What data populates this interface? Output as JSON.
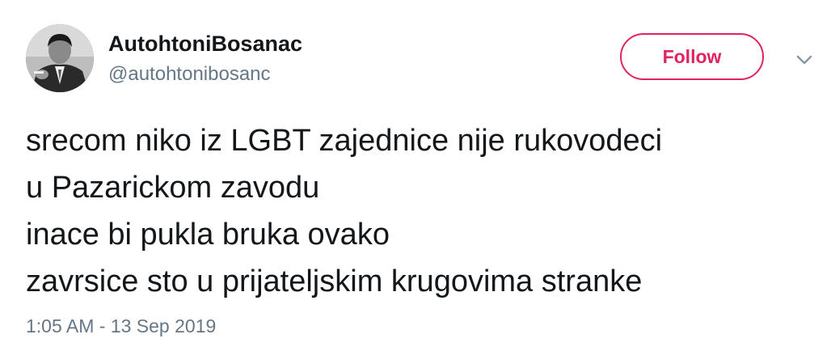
{
  "user": {
    "display_name": "AutohtoniBosanac",
    "handle": "@autohtonibosanc",
    "avatar_icon": "profile-photo"
  },
  "actions": {
    "follow_label": "Follow",
    "menu_icon": "chevron-down-icon",
    "accent_color": "#e0245e"
  },
  "tweet": {
    "lines": [
      "srecom niko iz LGBT zajednice nije rukovodeci",
      "u Pazarickom zavodu",
      "inace bi pukla bruka ovako",
      "zavrsice sto u prijateljskim krugovima stranke"
    ],
    "timestamp": "1:05 AM - 13 Sep 2019"
  }
}
